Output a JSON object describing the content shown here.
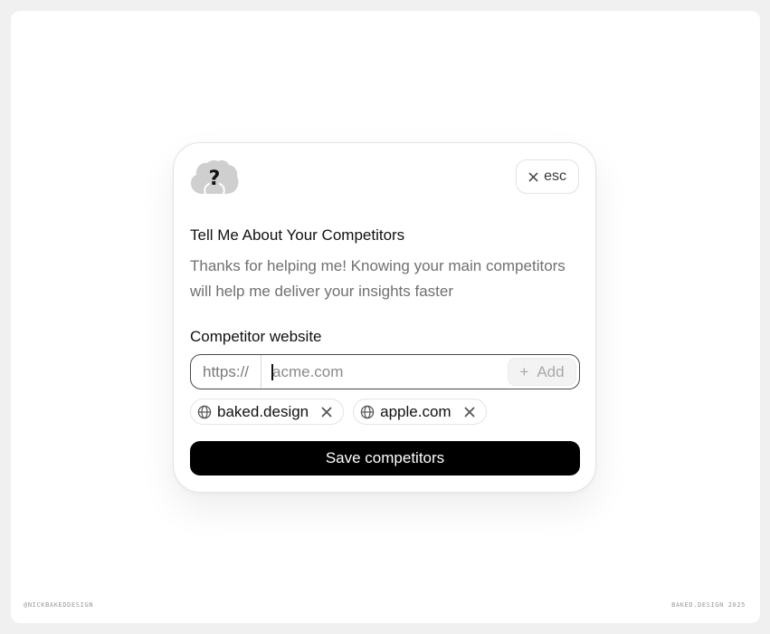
{
  "modal": {
    "close_label": "esc",
    "title": "Tell Me About Your Competitors",
    "description": "Thanks for helping me! Knowing your main competitors will help me deliver your insights faster",
    "field_label": "Competitor website",
    "input_prefix": "https://",
    "input_placeholder": "acme.com",
    "input_value": "",
    "add_label": "Add",
    "competitors": [
      {
        "label": "baked.design",
        "icon": "globe-icon"
      },
      {
        "label": "apple.com",
        "icon": "globe-icon"
      }
    ],
    "save_label": "Save competitors"
  },
  "footer": {
    "left": "@NICKBAKEDDESIGN",
    "right": "BAKED.DESIGN 2025"
  },
  "colors": {
    "accent": "#000000",
    "icon_gray": "#cfcfcf",
    "muted_text": "#707070"
  }
}
